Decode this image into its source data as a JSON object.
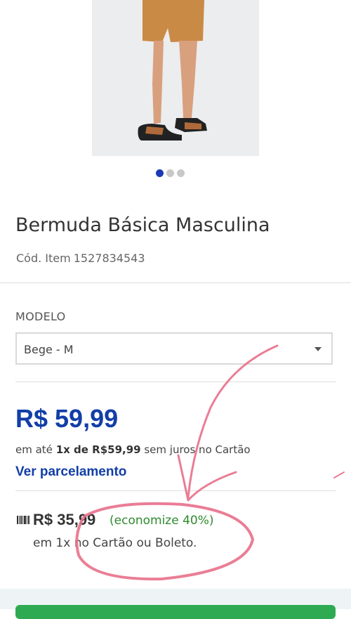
{
  "product": {
    "title": "Bermuda Básica Masculina",
    "code_label": "Cód. Item",
    "code_value": "1527834543"
  },
  "gallery": {
    "dots": [
      {
        "active": true
      },
      {
        "active": false
      },
      {
        "active": false
      }
    ]
  },
  "variant": {
    "label": "MODELO",
    "selected": "Bege - M"
  },
  "pricing": {
    "price": "R$ 59,99",
    "installment_prefix": "em até ",
    "installment_bold": "1x de R$59,99",
    "installment_suffix": " sem juros no Cartão",
    "installment_link": "Ver parcelamento",
    "discount_price": "R$ 35,99",
    "discount_savings": "(economize 40%)",
    "discount_note": "em 1x no Cartão ou Boleto."
  },
  "colors": {
    "brand_blue": "#123ea7",
    "savings_green": "#2e8b2e",
    "buy_green": "#2eab52",
    "annotation_pink": "#e8708a"
  }
}
